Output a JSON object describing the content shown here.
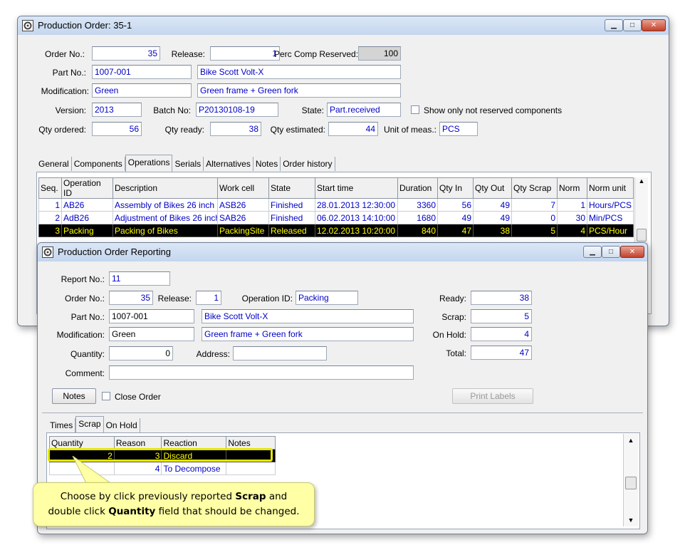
{
  "main_window": {
    "title": "Production Order: 35-1",
    "order_no_label": "Order No.:",
    "order_no": "35",
    "release_label": "Release:",
    "release": "1",
    "perc_comp_label": "Perc Comp Reserved:",
    "perc_comp": "100",
    "part_no_label": "Part No.:",
    "part_no": "1007-001",
    "part_desc": "Bike Scott Volt-X",
    "modification_label": "Modification:",
    "modification": "Green",
    "modification_desc": "Green frame + Green fork",
    "version_label": "Version:",
    "version": "2013",
    "batch_label": "Batch No:",
    "batch": "P20130108-19",
    "state_label": "State:",
    "state": "Part.received",
    "show_only_label": "Show only not reserved components",
    "qty_ordered_label": "Qty ordered:",
    "qty_ordered": "56",
    "qty_ready_label": "Qty ready:",
    "qty_ready": "38",
    "qty_estimated_label": "Qty estimated:",
    "qty_estimated": "44",
    "unit_label": "Unit of meas.:",
    "unit": "PCS",
    "tabs": [
      "General",
      "Components",
      "Operations",
      "Serials",
      "Alternatives",
      "Notes",
      "Order history"
    ],
    "active_tab": "Operations",
    "grid_headers": [
      "Seq.",
      "Operation ID",
      "Description",
      "Work cell",
      "State",
      "Start time",
      "Duration",
      "Qty In",
      "Qty Out",
      "Qty Scrap",
      "Norm",
      "Norm unit"
    ],
    "grid_rows": [
      [
        "1",
        "AB26",
        "Assembly of Bikes 26 inch",
        "ASB26",
        "Finished",
        "28.01.2013 12:30:00",
        "3360",
        "56",
        "49",
        "7",
        "1",
        "Hours/PCS"
      ],
      [
        "2",
        "AdB26",
        "Adjustment of Bikes 26 inch",
        "SAB26",
        "Finished",
        "06.02.2013 14:10:00",
        "1680",
        "49",
        "49",
        "0",
        "30",
        "Min/PCS"
      ],
      [
        "3",
        "Packing",
        "Packing of Bikes",
        "PackingSite",
        "Released",
        "12.02.2013 10:20:00",
        "840",
        "47",
        "38",
        "5",
        "4",
        "PCS/Hour"
      ]
    ],
    "selected_row": 2
  },
  "report_window": {
    "title": "Production Order Reporting",
    "report_no_label": "Report No.:",
    "report_no": "11",
    "order_no_label": "Order No.:",
    "order_no": "35",
    "release_label": "Release:",
    "release": "1",
    "operation_id_label": "Operation ID:",
    "operation_id": "Packing",
    "part_no_label": "Part No.:",
    "part_no": "1007-001",
    "part_desc": "Bike Scott Volt-X",
    "modification_label": "Modification:",
    "modification": "Green",
    "modification_desc": "Green frame + Green fork",
    "quantity_label": "Quantity:",
    "quantity": "0",
    "address_label": "Address:",
    "address": "",
    "comment_label": "Comment:",
    "comment": "",
    "ready_label": "Ready:",
    "ready": "38",
    "scrap_label": "Scrap:",
    "scrap": "5",
    "on_hold_label": "On Hold:",
    "on_hold": "4",
    "total_label": "Total:",
    "total": "47",
    "notes_button": "Notes",
    "close_order_label": "Close Order",
    "print_labels_button": "Print Labels",
    "tabs": [
      "Times",
      "Scrap",
      "On Hold"
    ],
    "active_tab": "Scrap",
    "grid_headers": [
      "Quantity",
      "Reason",
      "Reaction",
      "Notes"
    ],
    "grid_rows": [
      [
        "2",
        "3",
        "Discard",
        ""
      ],
      [
        "",
        "4",
        "To Decompose",
        ""
      ]
    ],
    "selected_row": 0
  },
  "callout": {
    "line1_pre": "Choose by click previously reported ",
    "line1_bold": "Scrap",
    "line1_post": " and",
    "line2_pre": "double click ",
    "line2_bold": "Quantity",
    "line2_post": " field that should be changed.",
    "highlight_color": "#e6e600",
    "background": "#ffffa6"
  }
}
